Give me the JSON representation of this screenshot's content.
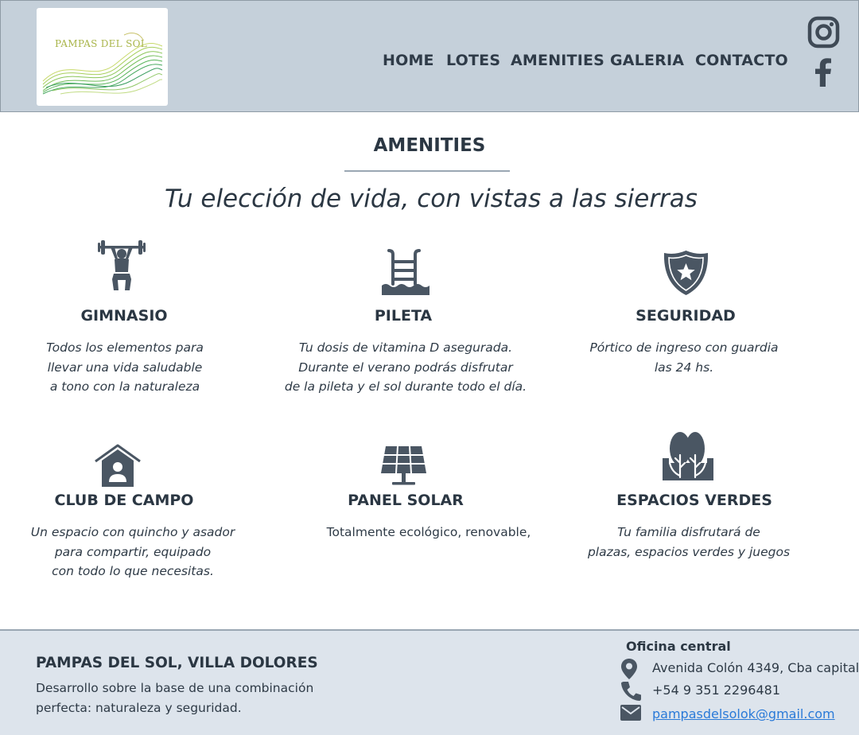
{
  "brand": {
    "logo_text": "PAMPAS DEL SOL"
  },
  "nav": {
    "items": [
      {
        "label": "HOME"
      },
      {
        "label": "LOTES"
      },
      {
        "label": "AMENITIES"
      },
      {
        "label": "GALERIA"
      },
      {
        "label": "CONTACTO"
      }
    ]
  },
  "social": {
    "instagram_icon": "instagram-icon",
    "facebook_icon": "facebook-icon"
  },
  "main": {
    "title": "AMENITIES",
    "tagline": "Tu elección de vida, con vistas a las sierras",
    "amenities": [
      {
        "icon": "weightlifting-icon",
        "name": "GIMNASIO",
        "description": "Todos los elementos para\nllevar una vida saludable\na tono con la naturaleza"
      },
      {
        "icon": "pool-ladder-icon",
        "name": "PILETA",
        "description": "Tu dosis de vitamina D asegurada.\nDurante el verano podrás disfrutar\nde la pileta y el sol durante todo el día."
      },
      {
        "icon": "security-shield-icon",
        "name": "SEGURIDAD",
        "description": "Pórtico de ingreso con guardia\nlas 24 hs."
      },
      {
        "icon": "house-person-icon",
        "name": "CLUB DE CAMPO",
        "description": "Un espacio con quincho y asador\npara compartir, equipado\ncon todo lo que necesitas."
      },
      {
        "icon": "solar-panel-icon",
        "name": "PANEL SOLAR",
        "description": "Totalmente ecológico, renovable,"
      },
      {
        "icon": "trees-icon",
        "name": "ESPACIOS VERDES",
        "description": "Tu familia disfrutará de\nplazas, espacios verdes y juegos"
      }
    ]
  },
  "footer": {
    "title": "PAMPAS DEL SOL, VILLA DOLORES",
    "text": "Desarrollo sobre la base de una combinación perfecta: naturaleza y seguridad.",
    "office_label": "Oficina central",
    "address": "Avenida Colón 4349, Cba capital",
    "phone": "+54 9 351 2296481",
    "email": "pampasdelsolok@gmail.com"
  },
  "colors": {
    "header_bg": "#c5d0da",
    "footer_bg": "#dde4ec",
    "icon": "#4a5663",
    "text": "#2b3743",
    "link": "#2a7ad8"
  }
}
